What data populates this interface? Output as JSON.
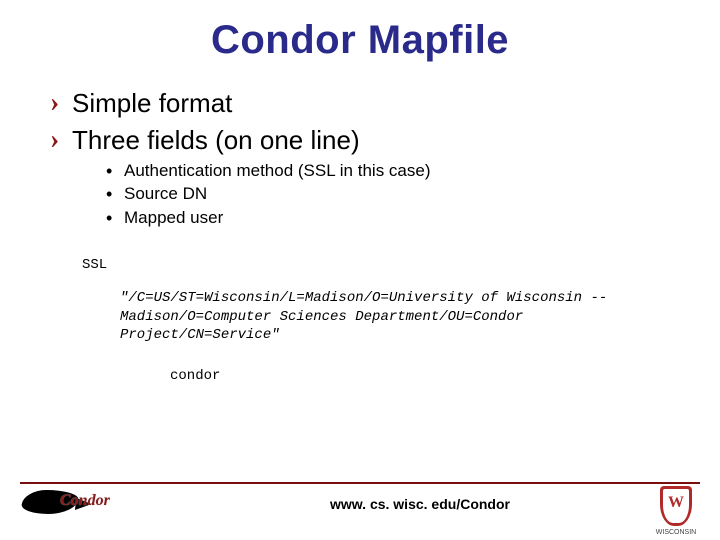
{
  "title": "Condor Mapfile",
  "bullets_l1": [
    "Simple format",
    "Three fields (on one line)"
  ],
  "bullets_l2": [
    "Authentication method (SSL in this case)",
    "Source DN",
    "Mapped user"
  ],
  "example": {
    "method": "SSL",
    "dn": "\"/C=US/ST=Wisconsin/L=Madison/O=University of Wisconsin --Madison/O=Computer Sciences Department/OU=Condor Project/CN=Service\"",
    "mapped_user": "condor"
  },
  "footer_url": "www. cs. wisc. edu/Condor",
  "logos": {
    "condor_text": "Condor",
    "uw_letter": "W",
    "uw_label": "WISCONSIN"
  }
}
